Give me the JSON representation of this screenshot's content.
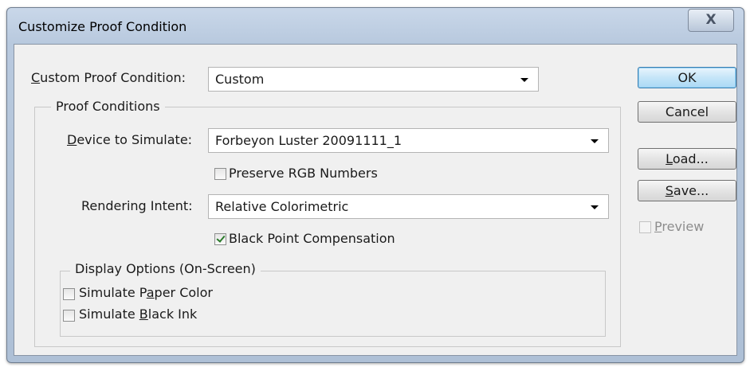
{
  "window": {
    "title": "Customize Proof Condition",
    "close_glyph": "X"
  },
  "custom_proof_condition": {
    "label_accel": "C",
    "label_rest": "ustom Proof Condition:",
    "value": "Custom"
  },
  "proof_conditions": {
    "legend": "Proof Conditions",
    "device_label_accel": "D",
    "device_label_rest": "evice to Simulate:",
    "device_value": "Forbeyon Luster 20091111_1",
    "preserve_rgb_label": "Preserve RGB Numbers",
    "preserve_rgb_checked": false,
    "intent_label": "Rendering Intent:",
    "intent_value": "Relative Colorimetric",
    "bpc_label": "Black Point Compensation",
    "bpc_checked": true
  },
  "display_options": {
    "legend": "Display Options (On-Screen)",
    "paper_pre": "Simulate P",
    "paper_accel": "a",
    "paper_post": "per Color",
    "paper_checked": false,
    "ink_pre": "Simulate ",
    "ink_accel": "B",
    "ink_post": "lack Ink",
    "ink_checked": false
  },
  "buttons": {
    "ok": "OK",
    "cancel": "Cancel",
    "load_accel": "L",
    "load_rest": "oad...",
    "save_accel": "S",
    "save_rest": "ave..."
  },
  "preview": {
    "accel": "P",
    "rest": "review",
    "checked": false,
    "enabled": false
  }
}
